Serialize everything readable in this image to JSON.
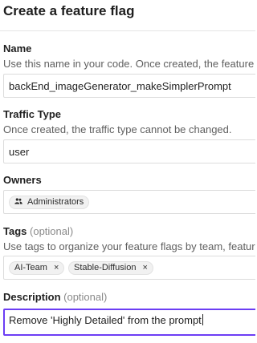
{
  "title": "Create a feature flag",
  "name": {
    "label": "Name",
    "help": "Use this name in your code. Once created, the feature flag name cannot be changed.",
    "value": "backEnd_imageGenerator_makeSimplerPrompt"
  },
  "traffic_type": {
    "label": "Traffic Type",
    "help": "Once created, the traffic type cannot be changed.",
    "value": "user"
  },
  "owners": {
    "label": "Owners",
    "items": [
      {
        "label": "Administrators",
        "icon": "group-icon"
      }
    ]
  },
  "tags": {
    "label": "Tags",
    "optional": "(optional)",
    "help": "Use tags to organize your feature flags by team, feature, or any other category.",
    "items": [
      {
        "label": "AI-Team",
        "remove": "×"
      },
      {
        "label": "Stable-Diffusion",
        "remove": "×"
      }
    ]
  },
  "description": {
    "label": "Description",
    "optional": "(optional)",
    "value": "Remove 'Highly Detailed' from the prompt"
  }
}
